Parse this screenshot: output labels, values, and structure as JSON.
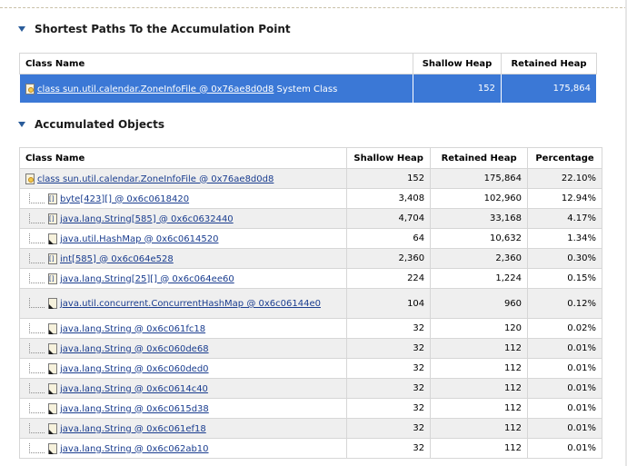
{
  "shortest_paths": {
    "title": "Shortest Paths To the Accumulation Point",
    "columns": [
      "Class Name",
      "Shallow Heap",
      "Retained Heap"
    ],
    "row": {
      "class_name_link": "class sun.util.calendar.ZoneInfoFile @ 0x76ae8d0d8",
      "class_name_suffix": "System Class",
      "shallow": "152",
      "retained": "175,864"
    }
  },
  "accumulated": {
    "title": "Accumulated Objects",
    "columns": [
      "Class Name",
      "Shallow Heap",
      "Retained Heap",
      "Percentage"
    ],
    "root": {
      "name": "class sun.util.calendar.ZoneInfoFile @ 0x76ae8d0d8",
      "shallow": "152",
      "retained": "175,864",
      "percentage": "22.10%"
    },
    "rows": [
      {
        "name": "byte[423][] @ 0x6c0618420",
        "shallow": "3,408",
        "retained": "102,960",
        "percentage": "12.94%"
      },
      {
        "name": "java.lang.String[585] @ 0x6c0632440",
        "shallow": "4,704",
        "retained": "33,168",
        "percentage": "4.17%"
      },
      {
        "name": "java.util.HashMap @ 0x6c0614520",
        "shallow": "64",
        "retained": "10,632",
        "percentage": "1.34%"
      },
      {
        "name": "int[585] @ 0x6c064e528",
        "shallow": "2,360",
        "retained": "2,360",
        "percentage": "0.30%"
      },
      {
        "name": "java.lang.String[25][] @ 0x6c064ee60",
        "shallow": "224",
        "retained": "1,224",
        "percentage": "0.15%"
      },
      {
        "name": "java.util.concurrent.ConcurrentHashMap @ 0x6c06144e0",
        "shallow": "104",
        "retained": "960",
        "percentage": "0.12%"
      },
      {
        "name": "java.lang.String @ 0x6c061fc18",
        "shallow": "32",
        "retained": "120",
        "percentage": "0.02%"
      },
      {
        "name": "java.lang.String @ 0x6c060de68",
        "shallow": "32",
        "retained": "112",
        "percentage": "0.01%"
      },
      {
        "name": "java.lang.String @ 0x6c060ded0",
        "shallow": "32",
        "retained": "112",
        "percentage": "0.01%"
      },
      {
        "name": "java.lang.String @ 0x6c0614c40",
        "shallow": "32",
        "retained": "112",
        "percentage": "0.01%"
      },
      {
        "name": "java.lang.String @ 0x6c0615d38",
        "shallow": "32",
        "retained": "112",
        "percentage": "0.01%"
      },
      {
        "name": "java.lang.String @ 0x6c061ef18",
        "shallow": "32",
        "retained": "112",
        "percentage": "0.01%"
      },
      {
        "name": "java.lang.String @ 0x6c062ab10",
        "shallow": "32",
        "retained": "112",
        "percentage": "0.01%"
      }
    ]
  }
}
